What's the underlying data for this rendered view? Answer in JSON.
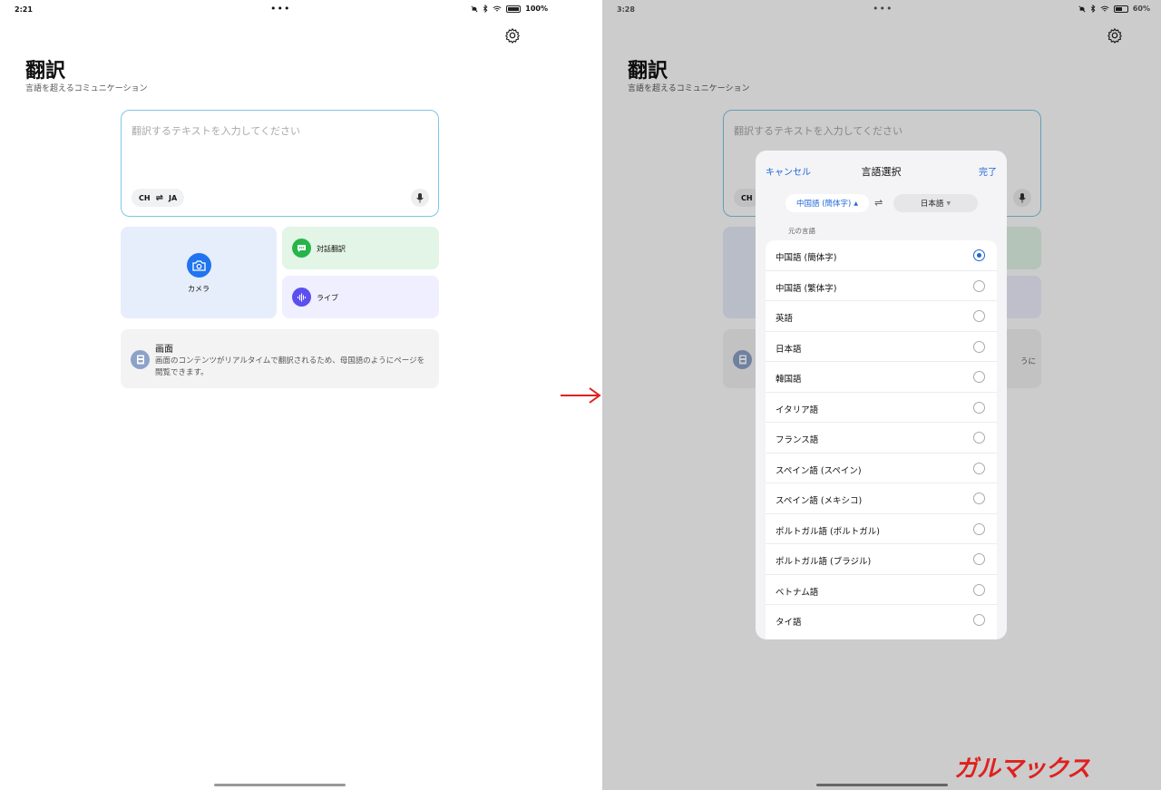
{
  "left": {
    "status": {
      "time": "2:21",
      "dots": "•••",
      "battery": "100%",
      "battery_level": 1.0
    },
    "header": {
      "title": "翻訳",
      "subtitle": "言語を超えるコミュニケーション",
      "settings_icon": "gear-icon"
    },
    "input": {
      "placeholder": "翻訳するテキストを入力してください",
      "source_lang": "CH",
      "target_lang": "JA",
      "swap_icon": "swap-arrows-icon",
      "mic_icon": "mic-icon"
    },
    "tiles": {
      "camera": {
        "label": "カメラ",
        "icon": "camera-icon"
      },
      "conversation": {
        "label": "対話翻訳",
        "icon": "chat-icon"
      },
      "live": {
        "label": "ライブ",
        "icon": "waveform-icon"
      },
      "screen": {
        "title": "画面",
        "description": "画面のコンテンツがリアルタイムで翻訳されるため、母国語のようにページを閲覧できます。",
        "icon": "screen-icon"
      }
    }
  },
  "right": {
    "status": {
      "time": "3:28",
      "dots": "•••",
      "battery": "60%",
      "battery_level": 0.6
    },
    "header": {
      "title": "翻訳",
      "subtitle": "言語を超えるコミュニケーション"
    },
    "input": {
      "placeholder": "翻訳するテキストを入力してください",
      "source_lang": "CH"
    },
    "behind_fragment": "うに",
    "sheet": {
      "cancel": "キャンセル",
      "title": "言語選択",
      "done": "完了",
      "source_pill": "中国語 (簡体字)",
      "target_pill": "日本語",
      "section_label": "元の言語",
      "languages": [
        {
          "name": "中国語 (簡体字)",
          "selected": true
        },
        {
          "name": "中国語 (繁体字)",
          "selected": false
        },
        {
          "name": "英語",
          "selected": false
        },
        {
          "name": "日本語",
          "selected": false
        },
        {
          "name": "韓国語",
          "selected": false
        },
        {
          "name": "イタリア語",
          "selected": false
        },
        {
          "name": "フランス語",
          "selected": false
        },
        {
          "name": "スペイン語 (スペイン)",
          "selected": false
        },
        {
          "name": "スペイン語 (メキシコ)",
          "selected": false
        },
        {
          "name": "ポルトガル語 (ポルトガル)",
          "selected": false
        },
        {
          "name": "ポルトガル語 (ブラジル)",
          "selected": false
        },
        {
          "name": "ベトナム語",
          "selected": false
        },
        {
          "name": "タイ語",
          "selected": false
        }
      ]
    }
  },
  "watermark": "ガルマックス",
  "colors": {
    "accent_blue": "#1f66d8",
    "camera_blue": "#1f74f0",
    "conv_green": "#27b54a",
    "live_purple": "#5b4ff0",
    "arrow_red": "#e02020"
  }
}
